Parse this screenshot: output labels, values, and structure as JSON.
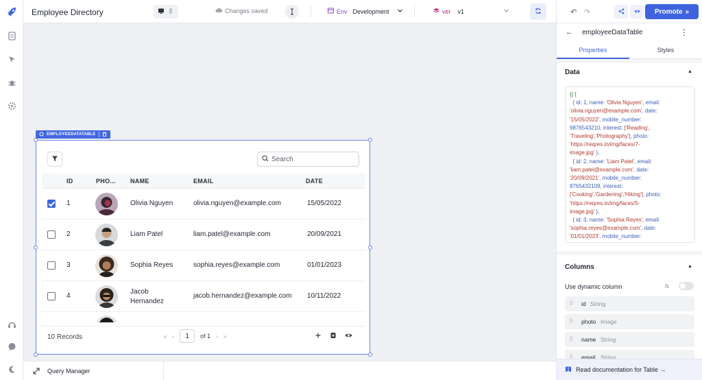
{
  "header": {
    "app_title": "Employee Directory",
    "save_status": "Changes saved",
    "env_label": "Env",
    "env_value": "Development",
    "ver_label": "ver",
    "ver_value": "v1"
  },
  "component_label": "EMPLOYEEDATATABLE",
  "table": {
    "search_placeholder": "Search",
    "columns": [
      "ID",
      "PHO...",
      "NAME",
      "EMAIL",
      "DATE"
    ],
    "rows": [
      {
        "id": "1",
        "name": "Olivia Nguyen",
        "email": "olivia.nguyen@example.com",
        "date": "15/05/2022",
        "checked": true
      },
      {
        "id": "2",
        "name": "Liam Patel",
        "email": "liam.patel@example.com",
        "date": "20/09/2021",
        "checked": false
      },
      {
        "id": "3",
        "name": "Sophia Reyes",
        "email": "sophia.reyes@example.com",
        "date": "01/01/2023",
        "checked": false
      },
      {
        "id": "4",
        "name_line1": "Jacob",
        "name_line2": "Hernandez",
        "email": "jacob.hernandez@example.com",
        "date": "10/11/2022",
        "checked": false
      }
    ],
    "records": "10 Records",
    "page": "1",
    "of_pages": "of 1"
  },
  "bottom": {
    "query_manager": "Query Manager"
  },
  "panel": {
    "promote_label": "Promote",
    "component_name": "employeeDataTable",
    "tab_properties": "Properties",
    "tab_styles": "Styles",
    "data_title": "Data",
    "columns_title": "Columns",
    "dynamic_column_label": "Use dynamic column",
    "fx_label": "fx",
    "columns": [
      {
        "name": "id",
        "type": "String"
      },
      {
        "name": "photo",
        "type": "Image"
      },
      {
        "name": "name",
        "type": "String"
      },
      {
        "name": "email",
        "type": "String"
      }
    ],
    "doc_link": "Read documentation for Table →",
    "code": {
      "l0": "{{ [",
      "l1a": "{ id: 1, name: ",
      "l1b": "'Olivia Nguyen'",
      "l1c": ", email:",
      "l2": "'olivia.nguyen@example.com'",
      "l2b": ", date:",
      "l3": "'15/05/2022'",
      "l3b": ", mobile_number:",
      "l4": "9876543210, interest: ",
      "l4b": "['Reading',",
      "l5": "'Traveling','Photography']",
      "l5b": ", photo:",
      "l6": "'https://reqres.in/img/faces/7-",
      "l7": "image.jpg'",
      "l7b": " },",
      "l8a": "{ id: 2, name: ",
      "l8b": "'Liam Patel'",
      "l8c": ", email:",
      "l9": "'liam.patel@example.com'",
      "l9b": ", date:",
      "l10": "'20/09/2021'",
      "l10b": ", mobile_number:",
      "l11": "8765432109, interest:",
      "l12": "['Cooking','Gardening','Hiking']",
      "l12b": ", photo:",
      "l13": "'https://reqres.in/img/faces/5-",
      "l14": "image.jpg'",
      "l14b": " },",
      "l15a": "{ id: 3, name: ",
      "l15b": "'Sophia Reyes'",
      "l15c": ", email:",
      "l16": "'sophia.reyes@example.com'",
      "l16b": ", date:",
      "l17": "'01/01/2023'",
      "l17b": ", mobile_number:"
    }
  },
  "colors": {
    "accent": "#3e63dd",
    "selection": "#6a86e6",
    "env_purple": "#8e44c9",
    "ver_pink": "#c2267f"
  },
  "icons": [
    "rocket-icon",
    "pages-icon",
    "queries-icon",
    "debug-icon",
    "settings-icon",
    "support-icon",
    "chat-icon",
    "theme-icon",
    "filter-icon",
    "search-icon",
    "plus-icon",
    "download-icon",
    "eye-icon",
    "undo-icon",
    "redo-icon",
    "share-icon",
    "preview-icon",
    "back-arrow-icon",
    "more-icon",
    "book-icon"
  ]
}
